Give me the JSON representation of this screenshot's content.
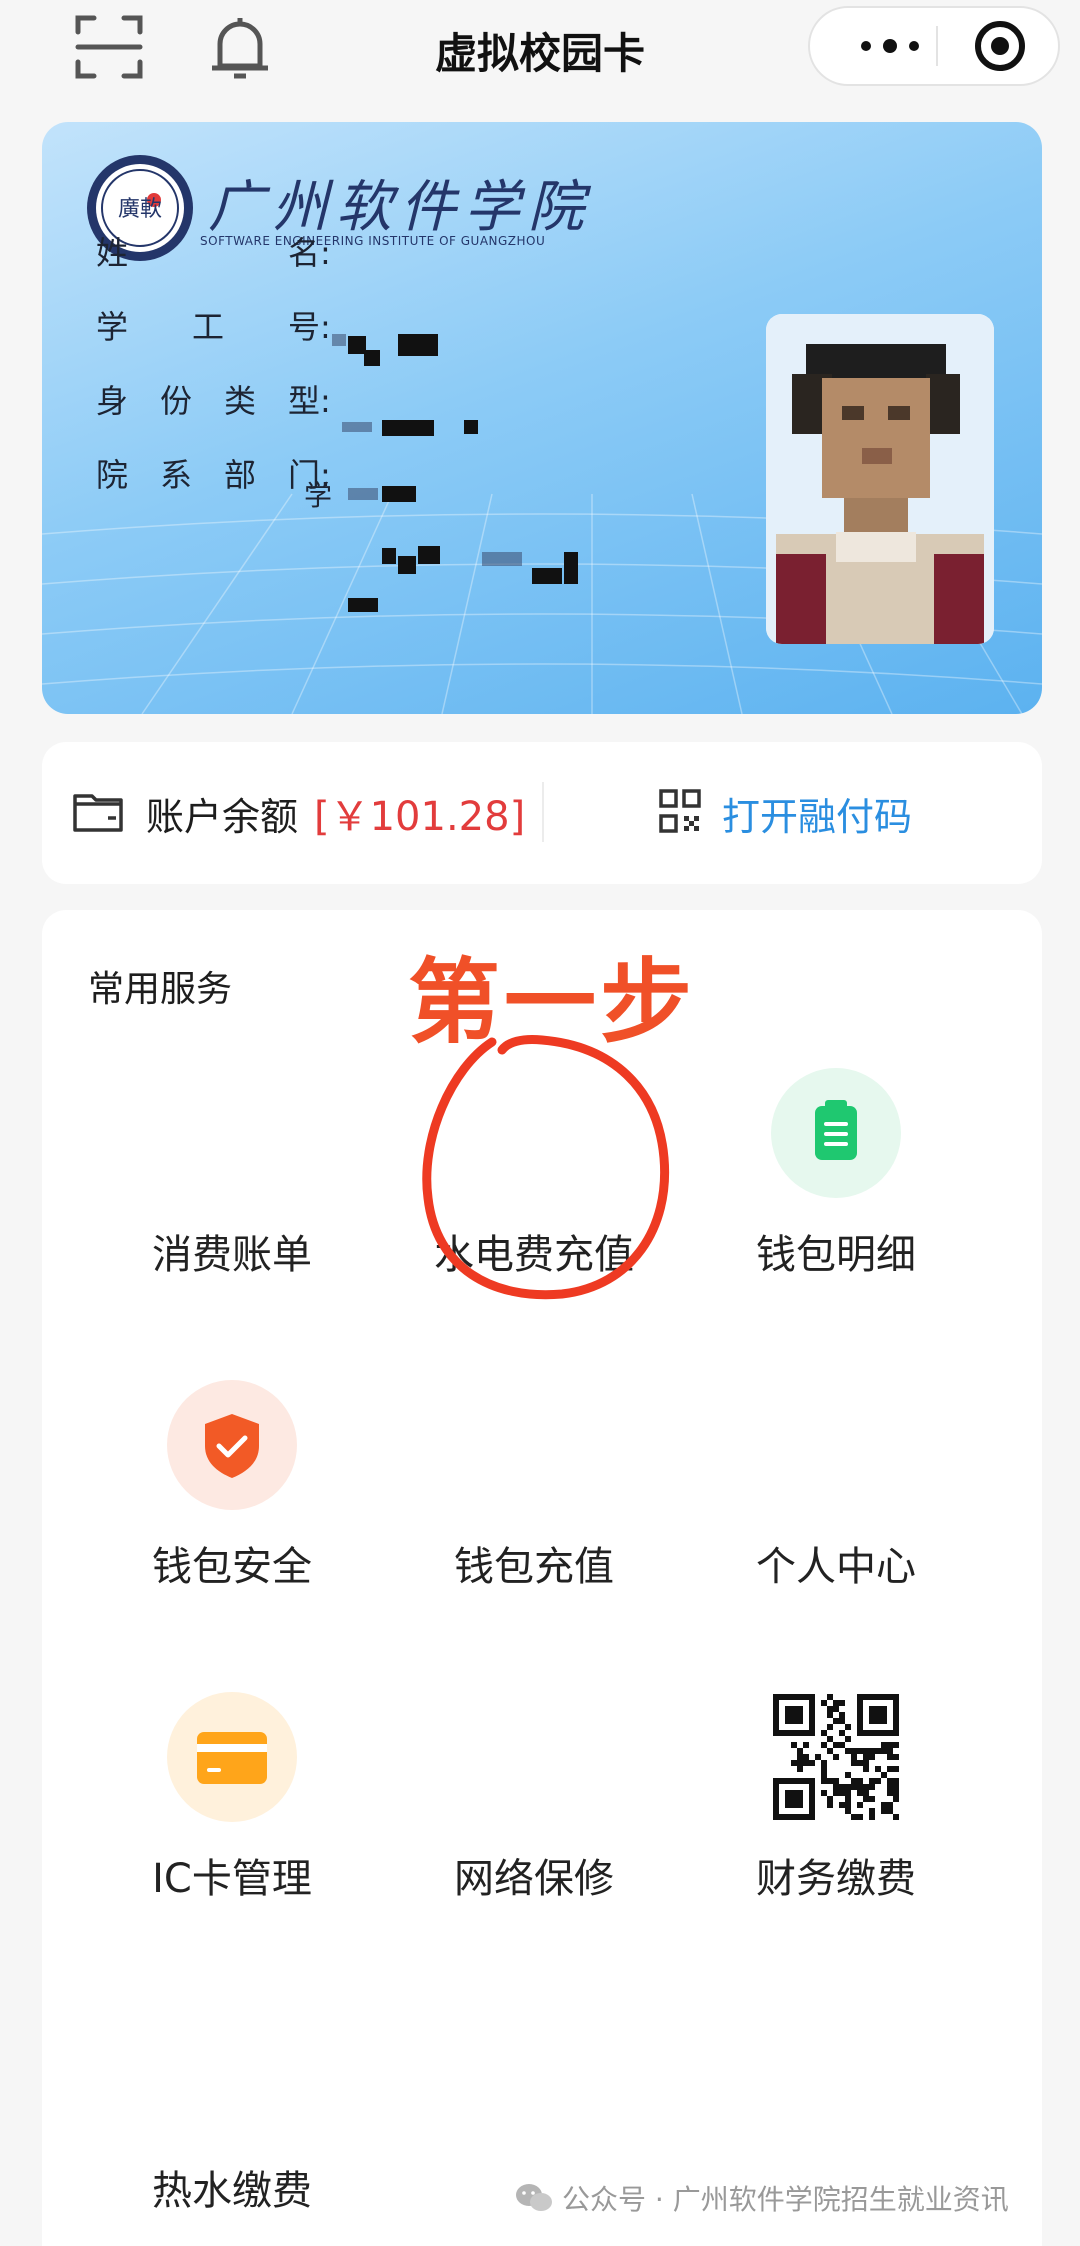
{
  "header": {
    "title": "虚拟校园卡"
  },
  "card": {
    "school_name": "广州软件学院",
    "school_name_en": "SOFTWARE ENGINEERING INSTITUTE OF GUANGZHOU",
    "seal_text": "廣軟",
    "fields": [
      {
        "label": "姓名",
        "colon": ":"
      },
      {
        "label": "学工号",
        "colon": ":"
      },
      {
        "label": "身份类型",
        "colon": ":"
      },
      {
        "label": "院系部门",
        "colon": ":"
      }
    ],
    "dept_partial": "学"
  },
  "balance": {
    "label": "账户余额",
    "amount": "[￥101.28]",
    "open_code_label": "打开融付码"
  },
  "services": {
    "title": "常用服务",
    "items": [
      {
        "label": "消费账单",
        "icon": "none"
      },
      {
        "label": "水电费充值",
        "icon": "none"
      },
      {
        "label": "钱包明细",
        "icon": "clipboard-icon",
        "color": "#1fc870",
        "bg": "#e6f8ee"
      },
      {
        "label": "钱包安全",
        "icon": "shield-check-icon",
        "color": "#f25a26",
        "bg": "#fde9e2"
      },
      {
        "label": "钱包充值",
        "icon": "none"
      },
      {
        "label": "个人中心",
        "icon": "none"
      },
      {
        "label": "IC卡管理",
        "icon": "card-icon",
        "color": "#ffa51a",
        "bg": "#fff1dc"
      },
      {
        "label": "网络保修",
        "icon": "none"
      },
      {
        "label": "财务缴费",
        "icon": "qr-code-icon"
      },
      {
        "label": "热水缴费",
        "icon": "none"
      }
    ]
  },
  "annotation": {
    "text": "第一步",
    "color": "#f05028"
  },
  "watermark": {
    "text": "公众号 · 广州软件学院招生就业资讯"
  }
}
